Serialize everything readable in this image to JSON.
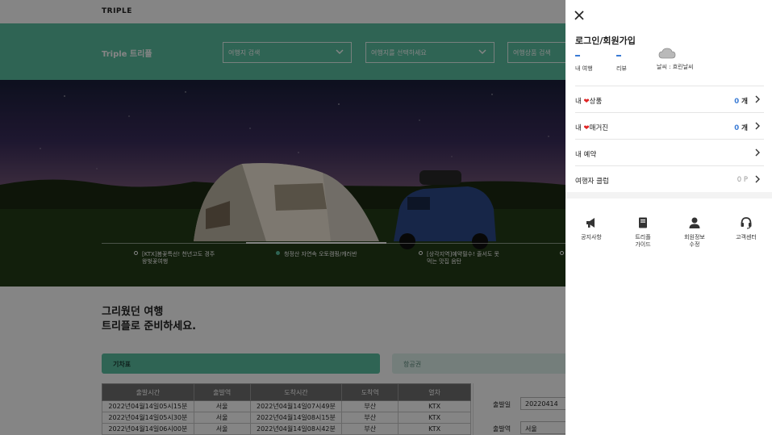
{
  "header": {
    "brand": "TRIPLE"
  },
  "search_bar": {
    "title": "Triple 트리플",
    "fields": [
      {
        "label": "여행지 검색"
      },
      {
        "label": "여행지를 선택하세요"
      },
      {
        "label": "여행상품 검색"
      }
    ]
  },
  "hero": {
    "slides": [
      {
        "line1": "[KTX]봄꽃특선! 천년고도 경주",
        "line2": "왕벚꽃여행"
      },
      {
        "line1": "청정산 자연속 오토캠핑/캐러반",
        "line2": ""
      },
      {
        "line1": "[상각지역]예약필수! 줄서도 못",
        "line2": "먹는 맛집 음탄"
      },
      {
        "line1": "",
        "line2": ""
      }
    ],
    "active_slide": 2
  },
  "tagline": {
    "line1": "그리웠던 여행",
    "line2": "트리플로 준비하세요."
  },
  "tabs": {
    "train": "기차표",
    "flight": "항공권"
  },
  "train_table": {
    "columns": [
      "출발시간",
      "출발역",
      "도착시간",
      "도착역",
      "열차"
    ],
    "rows": [
      [
        "2022년04월14일05시15분",
        "서울",
        "2022년04월14일07시49분",
        "부산",
        "KTX"
      ],
      [
        "2022년04월14일05시30분",
        "서울",
        "2022년04월14일08시15분",
        "부산",
        "KTX"
      ],
      [
        "2022년04월14일06시00분",
        "서울",
        "2022년04월14일08시42분",
        "부산",
        "KTX"
      ]
    ]
  },
  "booking_form": {
    "date_label": "출발일",
    "date_value": "20220414",
    "station_label": "출발역",
    "station_value": "서울"
  },
  "side_panel": {
    "login_label": "로그인/회원가입",
    "stats": {
      "trips_value": "-",
      "trips_label": "내 여행",
      "reviews_value": "-",
      "reviews_label": "리뷰"
    },
    "weather": {
      "label": "날씨 : 흐린날씨"
    },
    "menu": {
      "liked_products": {
        "prefix": "내 ",
        "heart": "❤",
        "label": "상품",
        "count": "0",
        "unit": " 개"
      },
      "liked_magazines": {
        "prefix": "내 ",
        "heart": "❤",
        "label": "매거진",
        "count": "0",
        "unit": " 개"
      },
      "reservations": {
        "label": "내 예약"
      },
      "travel_club": {
        "label": "여행자 클럽",
        "points": "0 P"
      }
    },
    "quick_links": {
      "notice": {
        "line1": "공지사항",
        "line2": ""
      },
      "guide": {
        "line1": "트리플",
        "line2": "가이드"
      },
      "profile": {
        "line1": "회원정보",
        "line2": "수정"
      },
      "support": {
        "line1": "고객센터",
        "line2": ""
      }
    }
  },
  "colors": {
    "accent_green": "#5ac0a2",
    "count_blue": "#3a7bd5",
    "heart_red": "#e02424"
  }
}
